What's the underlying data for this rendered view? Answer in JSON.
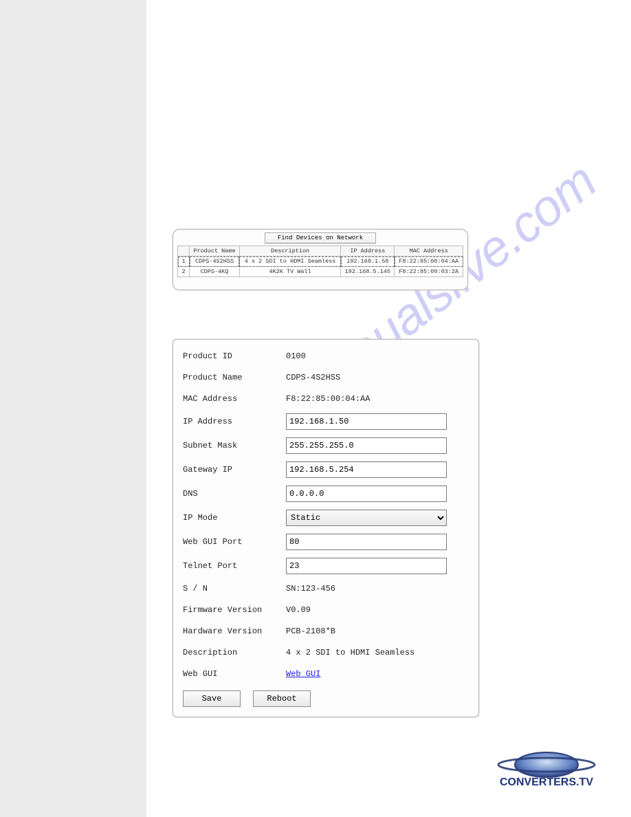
{
  "watermark": "manualslive.com",
  "devices_panel": {
    "find_button": "Find Devices on Network",
    "headers": {
      "idx": "",
      "name": "Product Name",
      "desc": "Description",
      "ip": "IP Address",
      "mac": "MAC Address"
    },
    "rows": [
      {
        "idx": "1",
        "name": "CDPS-4S2HSS",
        "desc": "4 x 2 SDI to HDMI Seamless",
        "ip": "192.168.1.50",
        "mac": "F8:22:85:00:04:AA"
      },
      {
        "idx": "2",
        "name": "CDPS-4KQ",
        "desc": "4K2K TV Wall",
        "ip": "192.168.5.145",
        "mac": "F8:22:85:00:03:2A"
      }
    ]
  },
  "details": {
    "labels": {
      "product_id": "Product ID",
      "product_name": "Product Name",
      "mac": "MAC Address",
      "ip": "IP Address",
      "subnet": "Subnet Mask",
      "gateway": "Gateway IP",
      "dns": "DNS",
      "ip_mode": "IP Mode",
      "web_port": "Web GUI Port",
      "telnet_port": "Telnet Port",
      "sn": "S / N",
      "fw": "Firmware Version",
      "hw": "Hardware Version",
      "desc": "Description",
      "web_gui": "Web GUI"
    },
    "values": {
      "product_id": "0100",
      "product_name": "CDPS-4S2HSS",
      "mac": "F8:22:85:00:04:AA",
      "ip": "192.168.1.50",
      "subnet": "255.255.255.0",
      "gateway": "192.168.5.254",
      "dns": "0.0.0.0",
      "ip_mode": "Static",
      "web_port": "80",
      "telnet_port": "23",
      "sn": "SN:123-456",
      "fw": "V0.09",
      "hw": "PCB-2108*B",
      "desc": "4 x 2 SDI to HDMI Seamless",
      "web_gui_link": "Web GUI"
    },
    "buttons": {
      "save": "Save",
      "reboot": "Reboot"
    }
  },
  "logo": {
    "text": "CONVERTERS.TV"
  }
}
